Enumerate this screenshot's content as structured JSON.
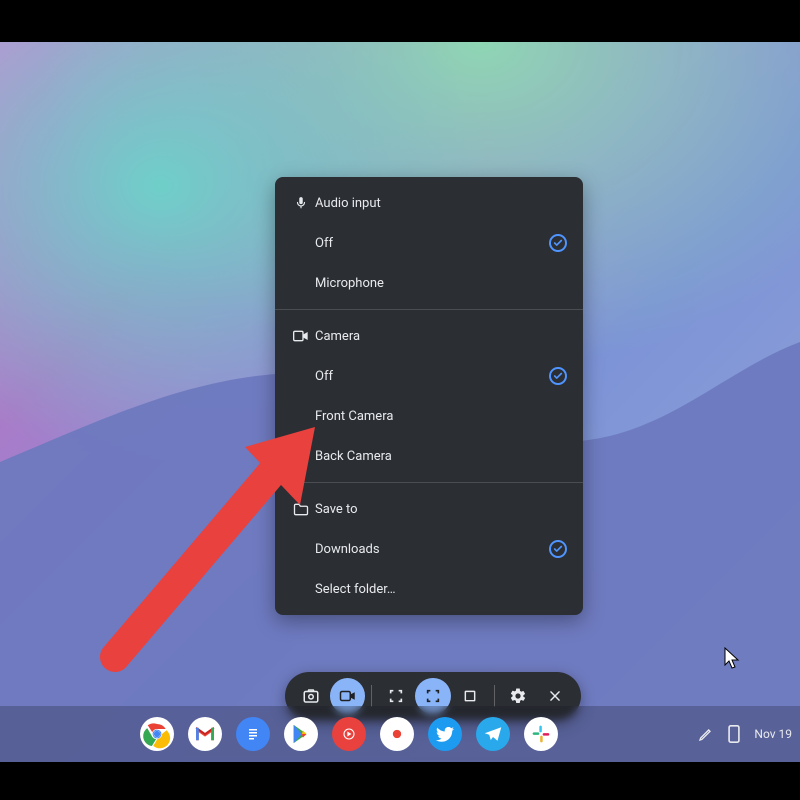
{
  "popup": {
    "audio": {
      "header": "Audio input",
      "off": "Off",
      "mic": "Microphone"
    },
    "camera": {
      "header": "Camera",
      "off": "Off",
      "front": "Front Camera",
      "back": "Back Camera"
    },
    "save": {
      "header": "Save to",
      "downloads": "Downloads",
      "select": "Select folder…"
    }
  },
  "tray": {
    "date": "Nov 19"
  },
  "colors": {
    "popup_bg": "#2b2e33",
    "accent_blue": "#8ab4f8",
    "check_ring": "#4f94ff",
    "arrow": "#e8413e"
  }
}
